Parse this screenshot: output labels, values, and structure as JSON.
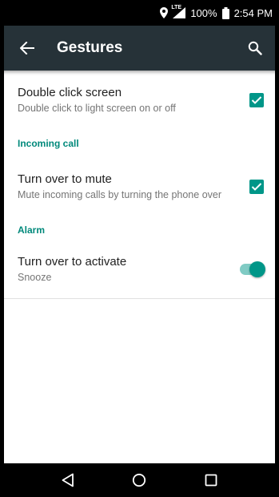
{
  "status_bar": {
    "network": "LTE",
    "battery": "100%",
    "time": "2:54 PM",
    "icons": [
      "location-icon",
      "signal-icon",
      "battery-icon"
    ]
  },
  "app_bar": {
    "title": "Gestures",
    "icons": [
      "back-arrow-icon",
      "search-icon"
    ]
  },
  "settings": {
    "double_click": {
      "title": "Double click screen",
      "summary": "Double click to light screen on or off",
      "checked": true
    },
    "incoming_call": {
      "header": "Incoming call",
      "turn_over_mute": {
        "title": "Turn over to mute",
        "summary": "Mute incoming calls by turning the phone over",
        "checked": true
      }
    },
    "alarm": {
      "header": "Alarm",
      "turn_over_activate": {
        "title": "Turn over to activate",
        "summary": "Snooze",
        "on": true
      }
    }
  },
  "nav_bar": {
    "icons": [
      "back-triangle-icon",
      "home-circle-icon",
      "recents-square-icon"
    ]
  },
  "colors": {
    "app_bar": "#263238",
    "accent": "#009688",
    "section_header": "#00897b",
    "switch_track": "#80cbc4"
  }
}
